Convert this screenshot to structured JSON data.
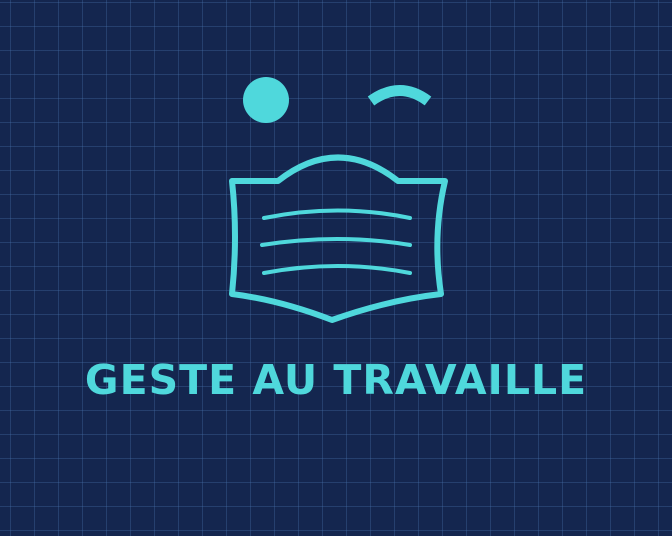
{
  "logo": {
    "wordmark": "GESTE AU TRAVAILLE",
    "icon_name": "winking-face-with-mask-icon",
    "colors": {
      "background": "#14264f",
      "grid": "#466eaa",
      "accent": "#4fd8dc"
    }
  }
}
